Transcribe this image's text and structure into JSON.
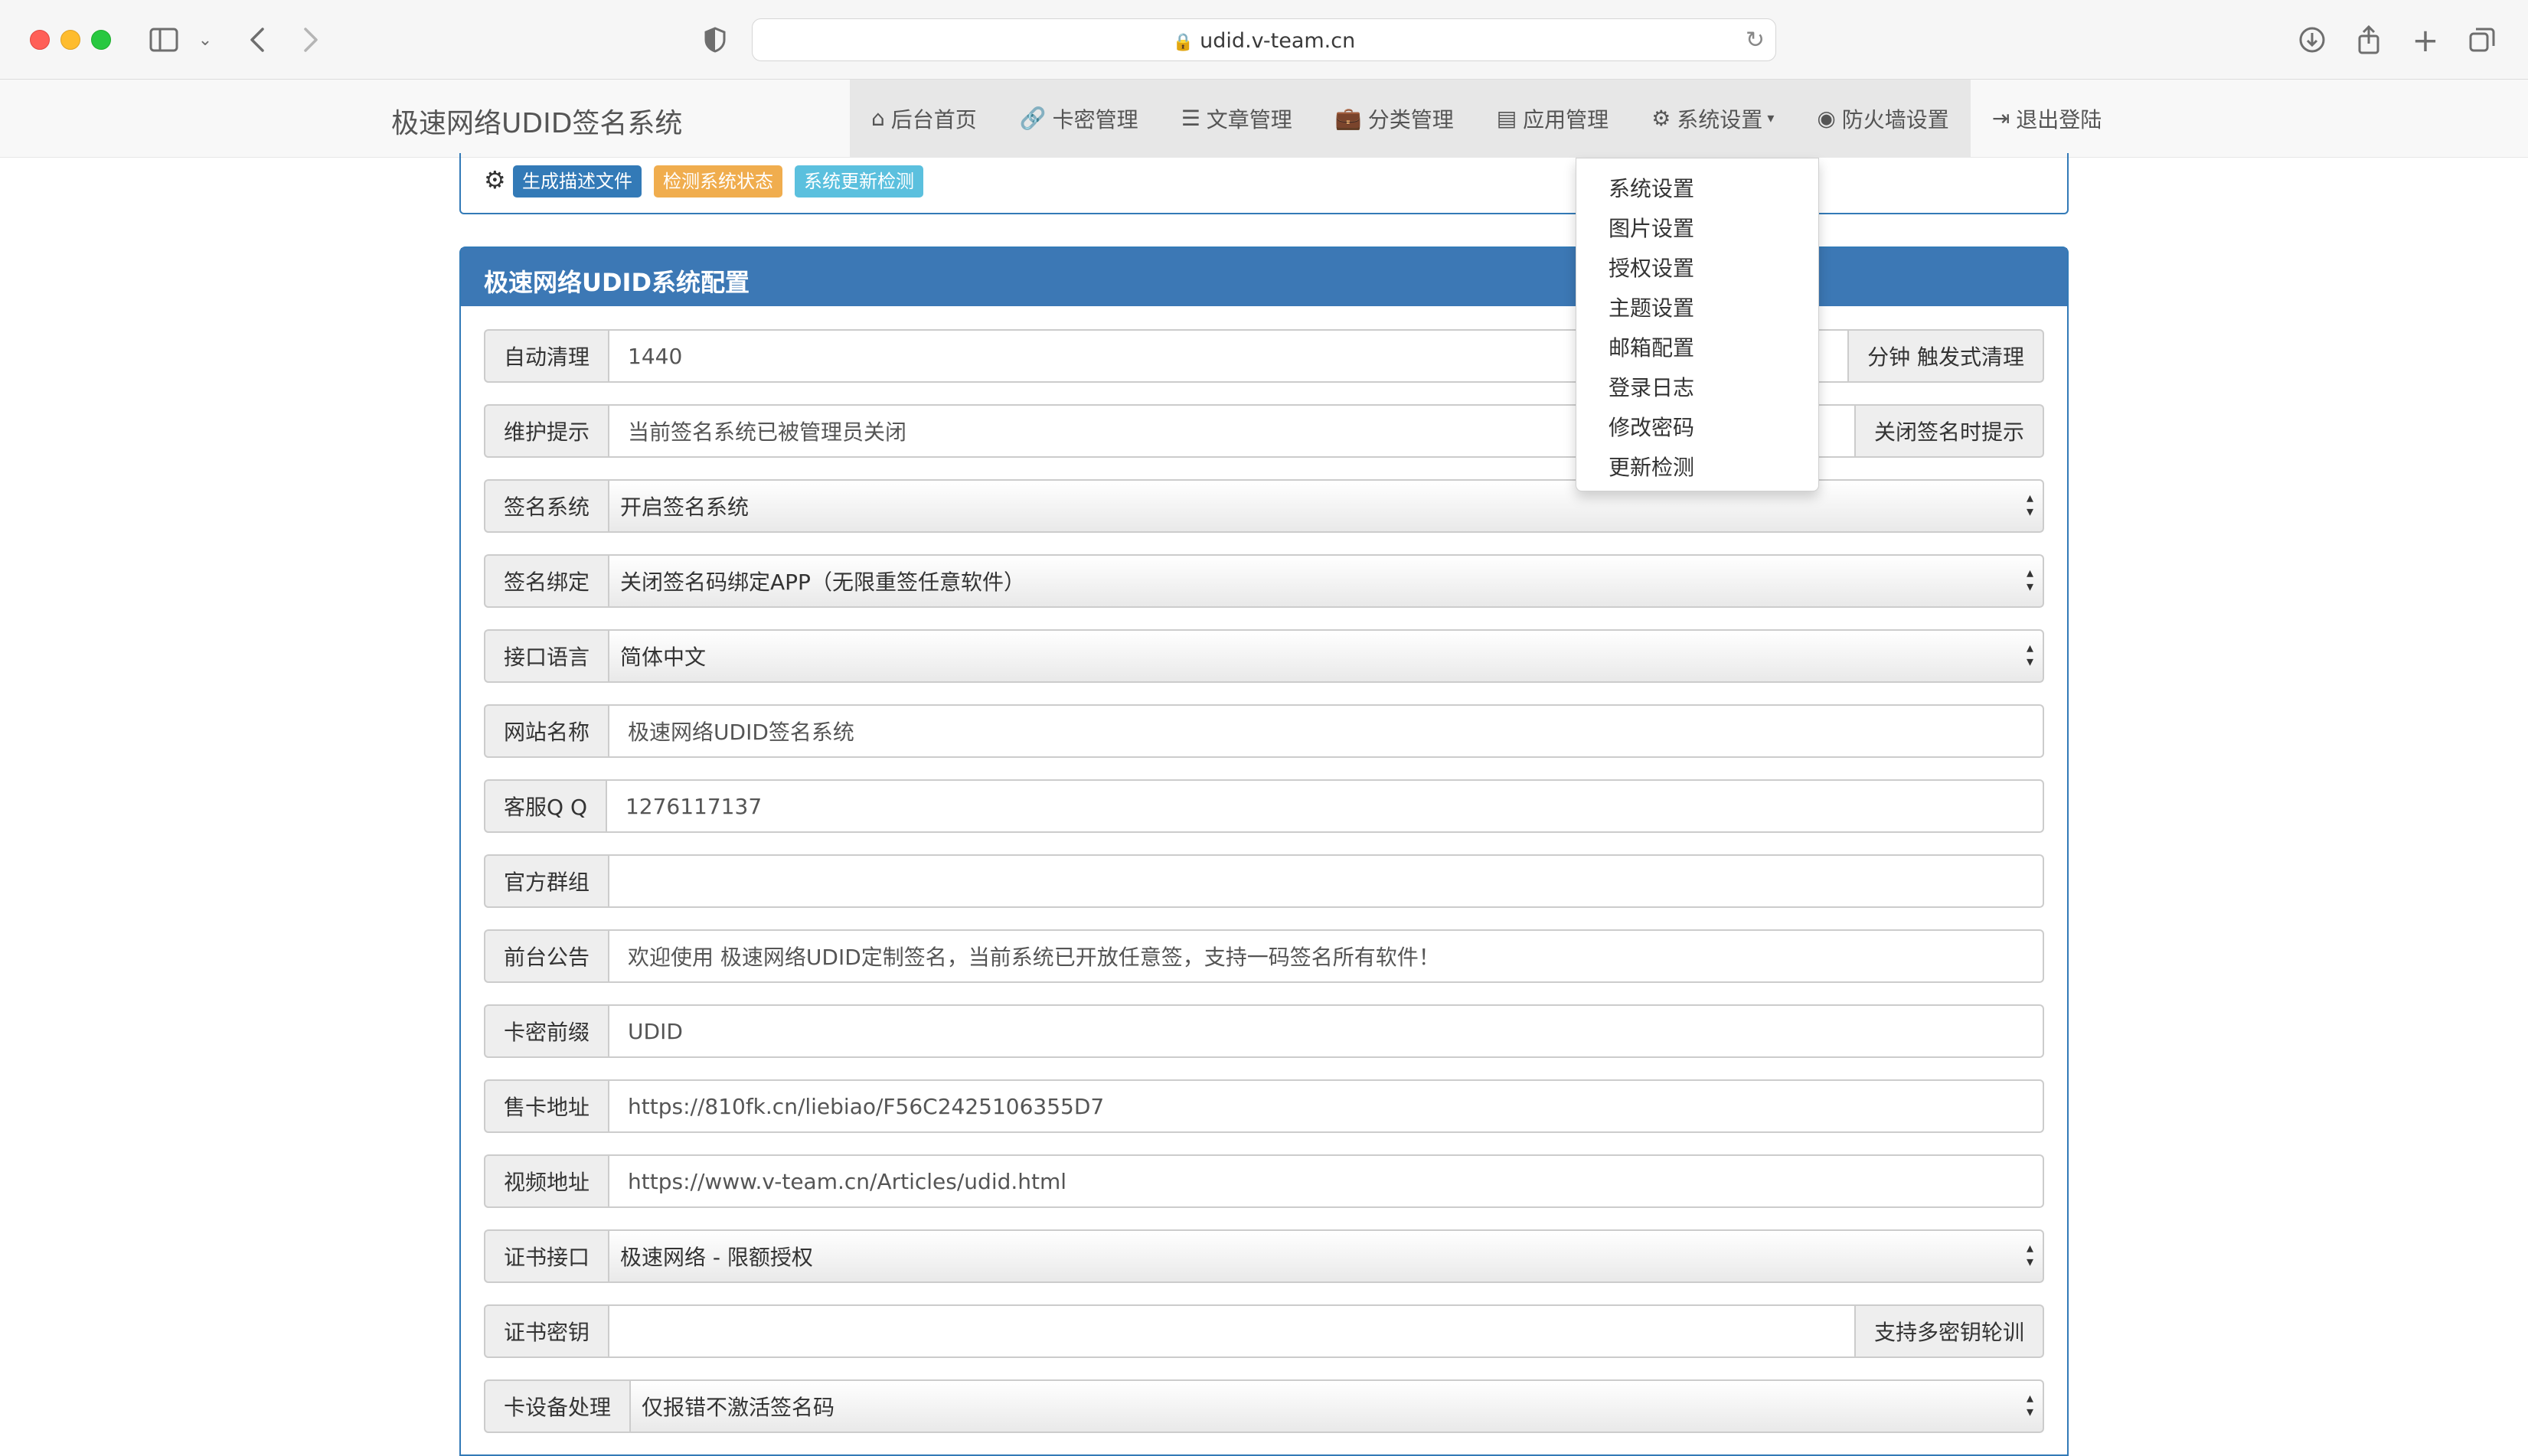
{
  "browser": {
    "url": "udid.v-team.cn"
  },
  "navbar": {
    "brand": "极速网络UDID签名系统",
    "items": [
      {
        "label": "后台首页",
        "icon": "home-icon"
      },
      {
        "label": "卡密管理",
        "icon": "link-icon"
      },
      {
        "label": "文章管理",
        "icon": "list-icon"
      },
      {
        "label": "分类管理",
        "icon": "briefcase-icon"
      },
      {
        "label": "应用管理",
        "icon": "server-icon"
      },
      {
        "label": "系统设置",
        "icon": "gear-icon"
      },
      {
        "label": "防火墙设置",
        "icon": "globe-icon"
      },
      {
        "label": "退出登陆",
        "icon": "logout-icon"
      }
    ]
  },
  "toolbar": {
    "generate_profile": "生成描述文件",
    "check_status": "检测系统状态",
    "check_update": "系统更新检测"
  },
  "dropdown": {
    "items": [
      "系统设置",
      "图片设置",
      "授权设置",
      "主题设置",
      "邮箱配置",
      "登录日志",
      "修改密码",
      "更新检测"
    ]
  },
  "config": {
    "title": "极速网络UDID系统配置",
    "fields": {
      "auto_clean": {
        "label": "自动清理",
        "value": "1440",
        "suffix": "分钟 触发式清理"
      },
      "maintenance": {
        "label": "维护提示",
        "value": "当前签名系统已被管理员关闭",
        "suffix": "关闭签名时提示"
      },
      "sign_system": {
        "label": "签名系统",
        "value": "开启签名系统"
      },
      "sign_binding": {
        "label": "签名绑定",
        "value": "关闭签名码绑定APP（无限重签任意软件）"
      },
      "api_language": {
        "label": "接口语言",
        "value": "简体中文"
      },
      "site_name": {
        "label": "网站名称",
        "value": "极速网络UDID签名系统"
      },
      "service_qq": {
        "label": "客服Q Q",
        "value": "1276117137"
      },
      "official_group": {
        "label": "官方群组",
        "value": ""
      },
      "announcement": {
        "label": "前台公告",
        "value": "欢迎使用 极速网络UDID定制签名，当前系统已开放任意签，支持一码签名所有软件！"
      },
      "card_prefix": {
        "label": "卡密前缀",
        "value": "UDID"
      },
      "card_shop": {
        "label": "售卡地址",
        "value": "https://810fk.cn/liebiao/F56C2425106355D7"
      },
      "video_url": {
        "label": "视频地址",
        "value": "https://www.v-team.cn/Articles/udid.html"
      },
      "cert_api": {
        "label": "证书接口",
        "value": "极速网络 - 限额授权"
      },
      "cert_key": {
        "label": "证书密钥",
        "value": "",
        "suffix": "支持多密钥轮训"
      },
      "device_handle": {
        "label": "卡设备处理",
        "value": "仅报错不激活签名码"
      }
    }
  }
}
